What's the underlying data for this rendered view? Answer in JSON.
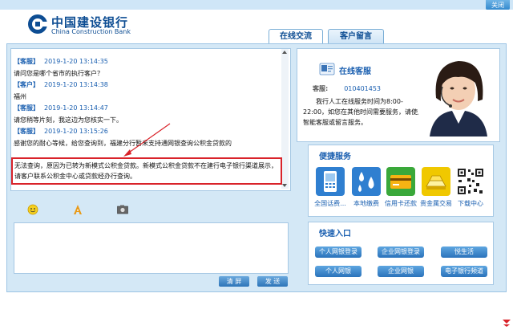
{
  "window": {
    "close_label": "关闭"
  },
  "brand": {
    "name_cn": "中国建设银行",
    "name_en": "China Construction Bank",
    "color": "#0d4d93"
  },
  "tabs": [
    {
      "label": "在线交流"
    },
    {
      "label": "客户留言"
    }
  ],
  "chat": {
    "messages": [
      {
        "sender": "【客服】",
        "time": "2019-1-20 13:14:35",
        "text": "请问您是哪个省市的执行客户？"
      },
      {
        "sender": "【客户】",
        "time": "2019-1-20 13:14:38",
        "text": "福州"
      },
      {
        "sender": "【客服】",
        "time": "2019-1-20 13:14:47",
        "text": "请您稍等片刻，我这边为您核实一下。"
      },
      {
        "sender": "【客服】",
        "time": "2019-1-20 13:15:26",
        "text": "感谢您的耐心等候，给您查询到，福建分行暂未支持通网银查询公积金贷款的"
      }
    ],
    "highlighted_text": "无法查询，原因为已转为新模式公积金贷款。新模式公积金贷款不在建行电子银行渠道展示，请客户联系公积金中心或贷款经办行查询。"
  },
  "toolbar": {
    "icons": [
      "emoji-icon",
      "font-icon",
      "screenshot-icon"
    ]
  },
  "input": {
    "value": ""
  },
  "buttons": {
    "clear": "清 屏",
    "send": "发 送"
  },
  "service": {
    "title": "在线客服",
    "agent_label": "客服:",
    "agent_id": "010401453",
    "description": "我行人工在线服务时间为8:00-22:00，如您在其他时间需要服务，请使用智能客服或留言服务。"
  },
  "convenient": {
    "title": "便捷服务",
    "items": [
      {
        "label": "全国话费...",
        "icon": "phone-icon",
        "color": "#2f7fd0"
      },
      {
        "label": "本地缴费",
        "icon": "water-drops-icon",
        "color": "#2f7fd0"
      },
      {
        "label": "信用卡还款",
        "icon": "credit-card-icon",
        "color": "#3aa83a"
      },
      {
        "label": "贵金属交易",
        "icon": "gold-bars-icon",
        "color": "#e0b000"
      },
      {
        "label": "下载中心",
        "icon": "qr-code-icon",
        "color": "#222222"
      }
    ]
  },
  "quick": {
    "title": "快速入口",
    "items": [
      {
        "label": "个人网银登录"
      },
      {
        "label": "企业网银登录"
      },
      {
        "label": "悦生活"
      },
      {
        "label": "个人网银"
      },
      {
        "label": "企业网银"
      },
      {
        "label": "电子银行频道"
      }
    ]
  }
}
